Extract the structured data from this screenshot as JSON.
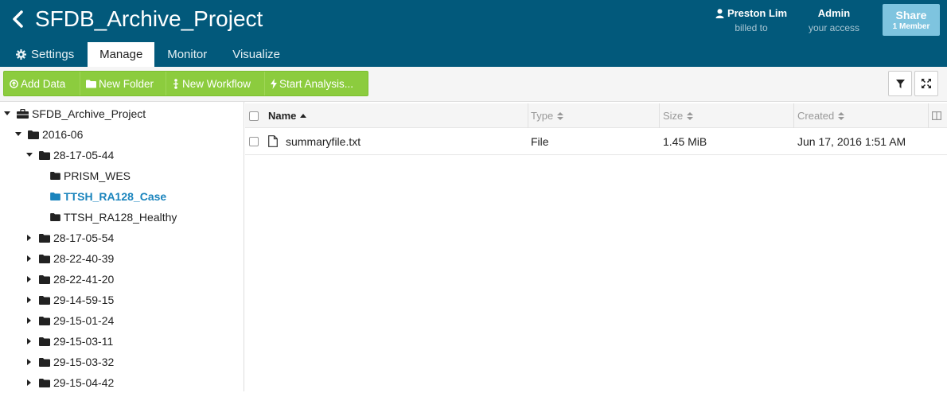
{
  "header": {
    "project_title": "SFDB_Archive_Project",
    "user": {
      "name": "Preston Lim",
      "sub": "billed to"
    },
    "access": {
      "name": "Admin",
      "sub": "your access"
    },
    "share": {
      "label": "Share",
      "sub": "1 Member"
    }
  },
  "tabs": [
    {
      "label": "Settings",
      "icon": "gear-icon"
    },
    {
      "label": "Manage",
      "active": true
    },
    {
      "label": "Monitor"
    },
    {
      "label": "Visualize"
    }
  ],
  "toolbar": {
    "add_data": "Add Data",
    "new_folder": "New Folder",
    "new_workflow": "New Workflow",
    "start_analysis": "Start Analysis..."
  },
  "tree": [
    {
      "label": "SFDB_Archive_Project",
      "state": "expanded",
      "icon": "briefcase-icon"
    },
    {
      "label": "2016-06",
      "state": "expanded",
      "icon": "folder-icon"
    },
    {
      "label": "28-17-05-44",
      "state": "expanded",
      "icon": "folder-icon"
    },
    {
      "label": "PRISM_WES",
      "state": "leaf",
      "icon": "folder-icon"
    },
    {
      "label": "TTSH_RA128_Case",
      "state": "leaf",
      "icon": "folder-icon",
      "selected": true
    },
    {
      "label": "TTSH_RA128_Healthy",
      "state": "leaf",
      "icon": "folder-icon"
    },
    {
      "label": "28-17-05-54",
      "state": "collapsed",
      "icon": "folder-icon"
    },
    {
      "label": "28-22-40-39",
      "state": "collapsed",
      "icon": "folder-icon"
    },
    {
      "label": "28-22-41-20",
      "state": "collapsed",
      "icon": "folder-icon"
    },
    {
      "label": "29-14-59-15",
      "state": "collapsed",
      "icon": "folder-icon"
    },
    {
      "label": "29-15-01-24",
      "state": "collapsed",
      "icon": "folder-icon"
    },
    {
      "label": "29-15-03-11",
      "state": "collapsed",
      "icon": "folder-icon"
    },
    {
      "label": "29-15-03-32",
      "state": "collapsed",
      "icon": "folder-icon"
    },
    {
      "label": "29-15-04-42",
      "state": "collapsed",
      "icon": "folder-icon"
    }
  ],
  "table": {
    "columns": {
      "name": "Name",
      "type": "Type",
      "size": "Size",
      "created": "Created"
    },
    "rows": [
      {
        "name": "summaryfile.txt",
        "type": "File",
        "size": "1.45 MiB",
        "created": "Jun 17, 2016 1:51 AM"
      }
    ]
  },
  "colors": {
    "header_bg": "#02597b",
    "accent_green": "#8ccc3e",
    "selected_link": "#1a84bd",
    "share_bg": "#7ec4df"
  }
}
